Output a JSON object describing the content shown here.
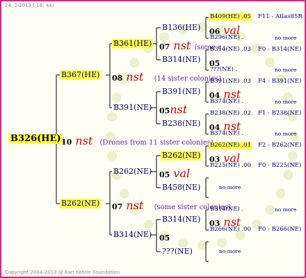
{
  "header": {
    "date": "24.  2-2013  ( 18: 44)"
  },
  "footer": {
    "copyright": "Copyright 2004-2013 @ Karl Kehrle Foundation."
  },
  "root": {
    "label": "B326(HE)",
    "gen_num": "10",
    "gen_tag": "nst",
    "colony": "(Drones from 11 sister colonies)"
  },
  "gen1": [
    {
      "label": "B367(HE)",
      "gen_num": "08",
      "gen_tag": "nst",
      "colony": "(14 sister colonies)"
    },
    {
      "label": "B262(NE)",
      "gen_num": "07",
      "gen_tag": "nst",
      "colony": "(some sister colonies)"
    }
  ],
  "gen2": [
    {
      "label": "B361(HE)",
      "gen_num": "07",
      "gen_tag": "nst",
      "colony": "(some c..."
    },
    {
      "label": "B391(NE)",
      "gen_num": "05",
      "gen_tag": "nst",
      "colony": ""
    },
    {
      "label": "B262(NE)",
      "gen_num": "05",
      "gen_tag": "val",
      "colony": ""
    },
    {
      "label": "B314(NE)",
      "gen_num": "05",
      "gen_tag": "",
      "colony": ""
    }
  ],
  "gen3": [
    {
      "label": "B136(HE)",
      "gen_num": "06",
      "gen_tag": "val"
    },
    {
      "label": "B314(NE)",
      "gen_num": "05",
      "gen_tag": ""
    },
    {
      "label": "B391(NE)",
      "gen_num": "04",
      "gen_tag": "nst"
    },
    {
      "label": "B238(NE)",
      "gen_num": "04",
      "gen_tag": "nst"
    },
    {
      "label": "B262(NE)",
      "gen_num": "03",
      "gen_tag": "val"
    },
    {
      "label": "B458(NE)",
      "gen_num": "",
      "gen_tag": ""
    },
    {
      "label": "B314(NE)",
      "gen_num": "03",
      "gen_tag": "nst"
    },
    {
      "label": "???(NE)",
      "gen_num": "",
      "gen_tag": ""
    }
  ],
  "gen4": [
    {
      "label": "B409(HE) .05",
      "info": "F11 - Atlas85R"
    },
    {
      "label": "B296(NE) .",
      "info": "no more"
    },
    {
      "label": "B314(NE) .03",
      "info": "F0 - B314(NE)"
    },
    {
      "label": "???(NE) .",
      "info": "no more"
    },
    {
      "label": "B391(NE) .03",
      "info": "F4 - B391(NE)"
    },
    {
      "label": "B374(NE) .",
      "info": "no more"
    },
    {
      "label": "B238(NE) .02",
      "info": "F1 - B238(NE)"
    },
    {
      "label": "B374(NE) .",
      "info": "no more"
    },
    {
      "label": "B262(NE) .01",
      "info": "F2 - B262(NE)"
    },
    {
      "label": "B225(NE) .00",
      "info": "F0 - B225(NE)"
    },
    {
      "label": "",
      "info": "no more"
    },
    {
      "label": "B314(NE) .",
      "info": "no more"
    },
    {
      "label": "B266(NE) .00",
      "info": "F0 - B266(NE)"
    },
    {
      "label": "",
      "info": "no more"
    }
  ]
}
